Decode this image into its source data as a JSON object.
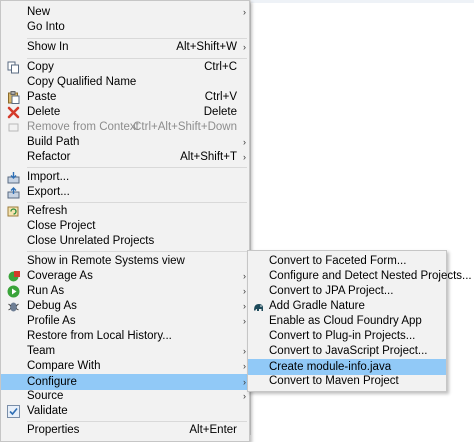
{
  "context_menu": {
    "items": [
      {
        "label": "New",
        "shortcut": "",
        "arrow": "›"
      },
      {
        "label": "Go Into",
        "shortcut": "",
        "arrow": ""
      },
      {
        "label": "Show In",
        "shortcut": "Alt+Shift+W",
        "arrow": "›"
      },
      {
        "label": "Copy",
        "shortcut": "Ctrl+C",
        "arrow": ""
      },
      {
        "label": "Copy Qualified Name",
        "shortcut": "",
        "arrow": ""
      },
      {
        "label": "Paste",
        "shortcut": "Ctrl+V",
        "arrow": ""
      },
      {
        "label": "Delete",
        "shortcut": "Delete",
        "arrow": ""
      },
      {
        "label": "Remove from Context",
        "shortcut": "Ctrl+Alt+Shift+Down",
        "arrow": ""
      },
      {
        "label": "Build Path",
        "shortcut": "",
        "arrow": "›"
      },
      {
        "label": "Refactor",
        "shortcut": "Alt+Shift+T",
        "arrow": "›"
      },
      {
        "label": "Import...",
        "shortcut": "",
        "arrow": ""
      },
      {
        "label": "Export...",
        "shortcut": "",
        "arrow": ""
      },
      {
        "label": "Refresh",
        "shortcut": "",
        "arrow": ""
      },
      {
        "label": "Close Project",
        "shortcut": "",
        "arrow": ""
      },
      {
        "label": "Close Unrelated Projects",
        "shortcut": "",
        "arrow": ""
      },
      {
        "label": "Show in Remote Systems view",
        "shortcut": "",
        "arrow": ""
      },
      {
        "label": "Coverage As",
        "shortcut": "",
        "arrow": "›"
      },
      {
        "label": "Run As",
        "shortcut": "",
        "arrow": "›"
      },
      {
        "label": "Debug As",
        "shortcut": "",
        "arrow": "›"
      },
      {
        "label": "Profile As",
        "shortcut": "",
        "arrow": "›"
      },
      {
        "label": "Restore from Local History...",
        "shortcut": "",
        "arrow": ""
      },
      {
        "label": "Team",
        "shortcut": "",
        "arrow": "›"
      },
      {
        "label": "Compare With",
        "shortcut": "",
        "arrow": "›"
      },
      {
        "label": "Configure",
        "shortcut": "",
        "arrow": "›"
      },
      {
        "label": "Source",
        "shortcut": "",
        "arrow": "›"
      },
      {
        "label": "Validate",
        "shortcut": "",
        "arrow": ""
      },
      {
        "label": "Properties",
        "shortcut": "Alt+Enter",
        "arrow": ""
      }
    ]
  },
  "configure_submenu": {
    "items": [
      {
        "label": "Convert to Faceted Form..."
      },
      {
        "label": "Configure and Detect Nested Projects..."
      },
      {
        "label": "Convert to JPA Project..."
      },
      {
        "label": "Add Gradle Nature"
      },
      {
        "label": "Enable as Cloud Foundry App"
      },
      {
        "label": "Convert to Plug-in Projects..."
      },
      {
        "label": "Convert to JavaScript Project..."
      },
      {
        "label": "Create module-info.java"
      },
      {
        "label": "Convert to Maven Project"
      }
    ]
  },
  "icons": {
    "copy": "copy-icon",
    "paste": "paste-icon",
    "delete": "delete-icon",
    "import": "import-icon",
    "export": "export-icon",
    "refresh": "refresh-icon",
    "coverage": "coverage-icon",
    "run": "run-icon",
    "debug": "debug-icon",
    "validate": "checkmark-icon",
    "gradle": "gradle-elephant-icon"
  },
  "colors": {
    "selection": "#91c9f7",
    "menu_bg": "#f2f2f2",
    "disabled": "#8d8d8d"
  }
}
